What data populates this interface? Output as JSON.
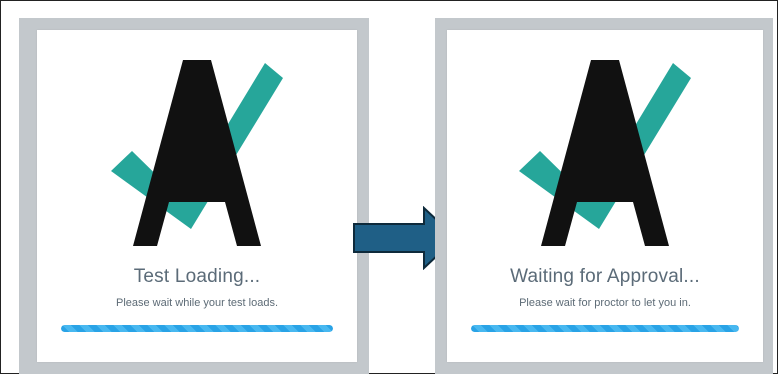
{
  "screens": [
    {
      "title": "Test Loading...",
      "subtitle": "Please wait while your test loads.",
      "progress_percent": 100
    },
    {
      "title": "Waiting for Approval...",
      "subtitle": "Please wait for proctor to let you in.",
      "progress_percent": 100
    }
  ],
  "logo": {
    "letter": "A",
    "check_color": "#26a69a",
    "letter_color": "#111111"
  },
  "arrow": {
    "icon": "arrow-right-icon",
    "fill": "#1f5f86",
    "stroke": "#0e2a3b"
  },
  "colors": {
    "panel_bg": "#c3c8cc",
    "card_bg": "#ffffff",
    "title": "#5b6b78",
    "progress": "#29a3e6"
  }
}
